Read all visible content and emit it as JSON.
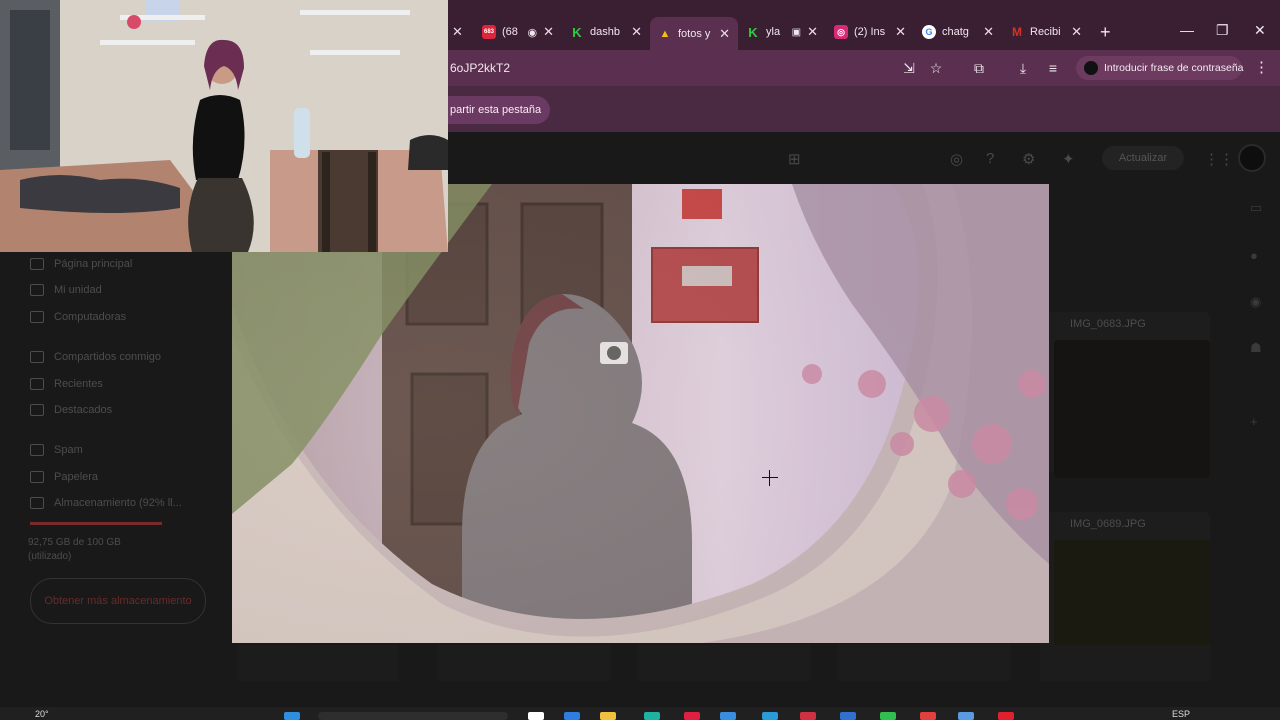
{
  "browser": {
    "tabs": [
      {
        "label": "(68",
        "favicon_color": "#e0243b",
        "favicon_text": "683",
        "active": false
      },
      {
        "label": "dashb",
        "favicon_color": "#2ecc40",
        "favicon_text": "K",
        "active": false
      },
      {
        "label": "fotos y",
        "favicon_color": "#3aa757",
        "favicon_text": "▲",
        "active": true
      },
      {
        "label": "yla",
        "favicon_color": "#2ecc40",
        "favicon_text": "K",
        "active": false
      },
      {
        "label": "(2) Ins",
        "favicon_color": "#d62976",
        "favicon_text": "◎",
        "active": false
      },
      {
        "label": "chatg",
        "favicon_color": "#ffffff",
        "favicon_text": "G",
        "active": false
      },
      {
        "label": "Recibi",
        "favicon_color": "#d93025",
        "favicon_text": "M",
        "active": false
      }
    ],
    "new_tab_symbol": "+",
    "close_symbol": "✕",
    "url": "6oJP2kkT2",
    "password_prompt": "Introducir frase de contraseña",
    "share_button": "partir esta pestaña",
    "window_controls": [
      "—",
      "❐",
      "✕"
    ]
  },
  "drive": {
    "update_button": "Actualizar",
    "sidebar": [
      {
        "label": "Página principal"
      },
      {
        "label": "Mi unidad"
      },
      {
        "label": "Computadoras"
      },
      {
        "label": "Compartidos conmigo"
      },
      {
        "label": "Recientes"
      },
      {
        "label": "Destacados"
      },
      {
        "label": "Spam"
      },
      {
        "label": "Papelera"
      },
      {
        "label": "Almacenamiento (92% ll..."
      }
    ],
    "storage_text": "92,75 GB de 100 GB (utilizado)",
    "get_more_storage": "Obtener más almacenamiento",
    "files": [
      {
        "name": "IMG_0683.JPG"
      },
      {
        "name": "IMG_0689.JPG"
      }
    ]
  },
  "taskbar": {
    "weather": "20°",
    "language": "ESP"
  },
  "colors": {
    "tab_strip": "#3a1f33",
    "active_tab": "#5a2f4f",
    "drive_bg": "#191919"
  }
}
